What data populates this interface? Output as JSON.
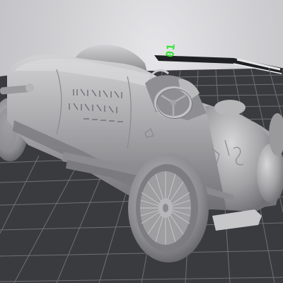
{
  "viewport": {
    "plate_label": "01",
    "plate_label_color": "#33e233",
    "background_color": "#cfcfd2",
    "bed_color": "#3a3b3f",
    "grid_color": "#6f7076",
    "model_color": "#a9a9ab",
    "model": "vintage-race-car"
  }
}
